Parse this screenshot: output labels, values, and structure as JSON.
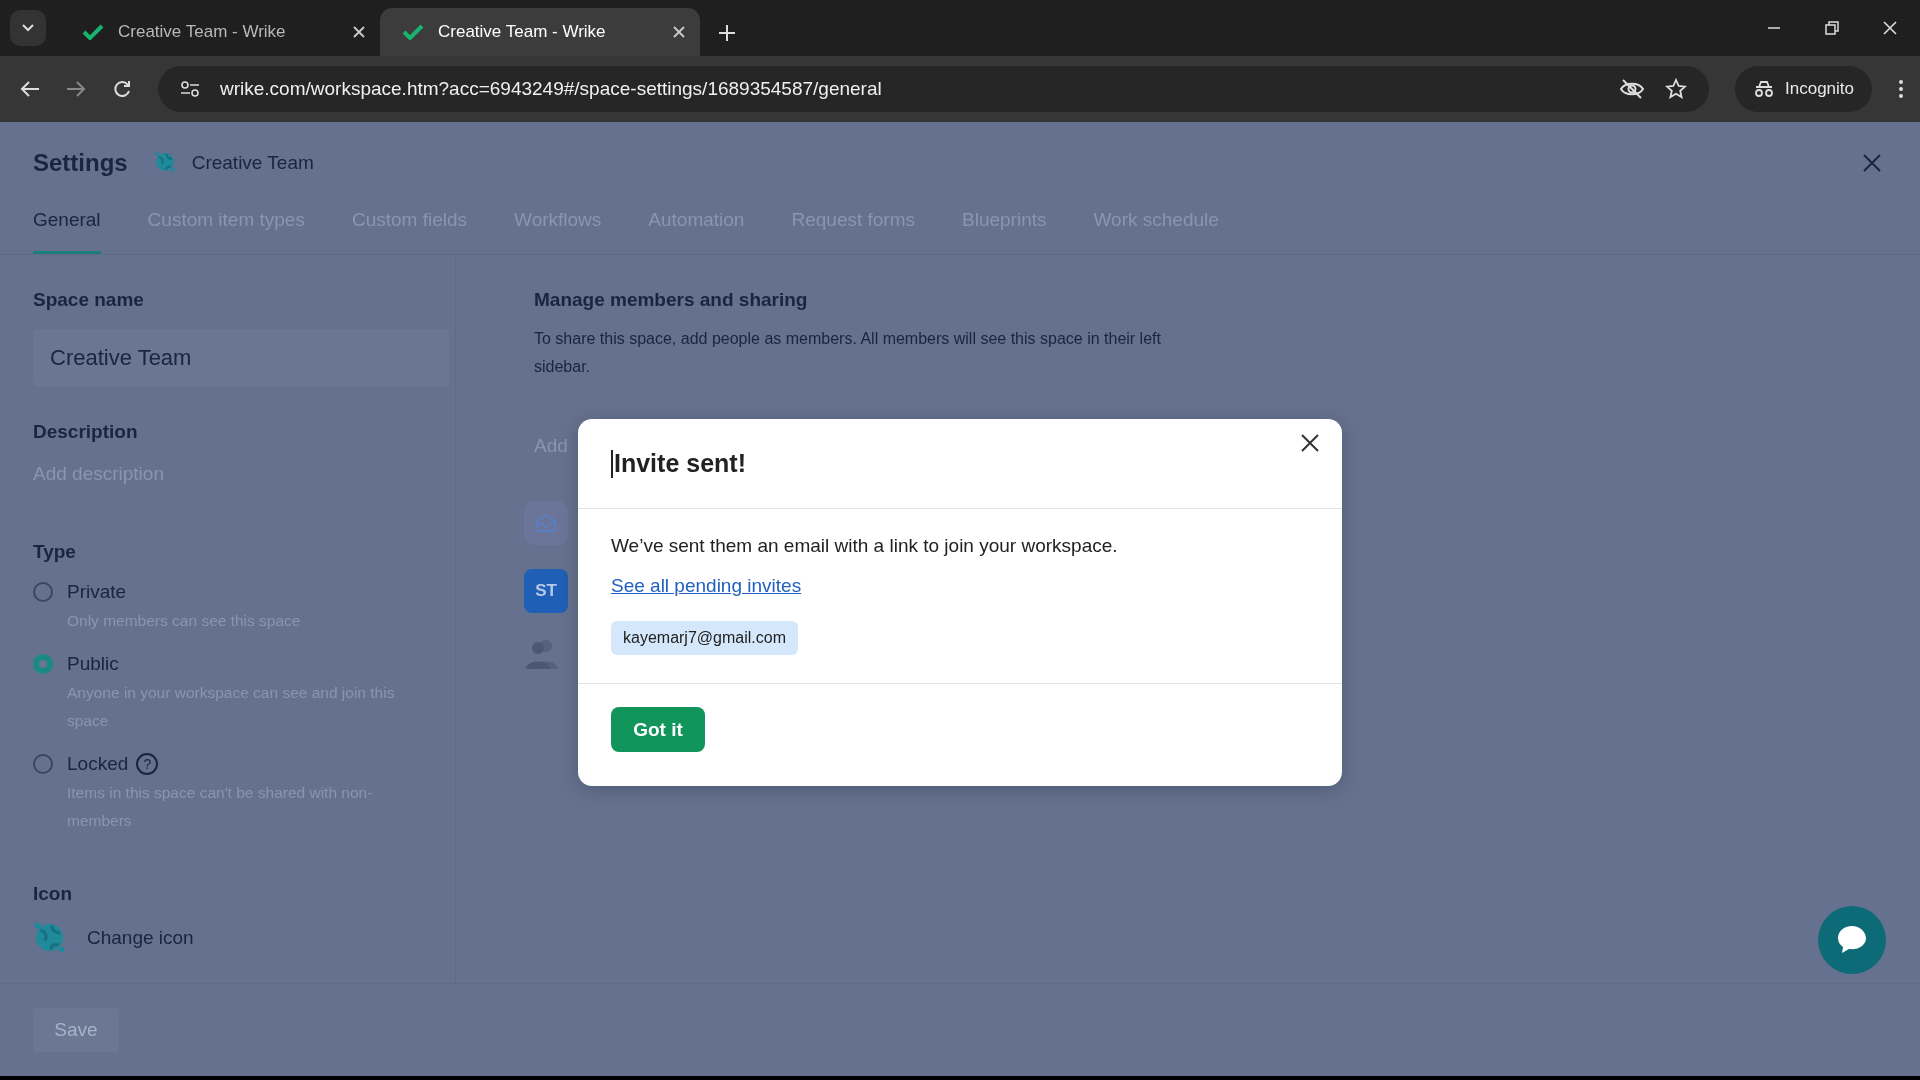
{
  "browser": {
    "tabs": [
      {
        "title": "Creative Team - Wrike",
        "selected": false
      },
      {
        "title": "Creative Team - Wrike",
        "selected": true
      }
    ],
    "url": "wrike.com/workspace.htm?acc=6943249#/space-settings/1689354587/general",
    "profile": "Incognito"
  },
  "settings": {
    "title": "Settings",
    "space": "Creative Team",
    "tabs": [
      {
        "label": "General",
        "selected": true
      },
      {
        "label": "Custom item types",
        "selected": false
      },
      {
        "label": "Custom fields",
        "selected": false
      },
      {
        "label": "Workflows",
        "selected": false
      },
      {
        "label": "Automation",
        "selected": false
      },
      {
        "label": "Request forms",
        "selected": false
      },
      {
        "label": "Blueprints",
        "selected": false
      },
      {
        "label": "Work schedule",
        "selected": false
      }
    ],
    "space_name_label": "Space name",
    "space_name_value": "Creative Team",
    "description_label": "Description",
    "description_placeholder": "Add description",
    "type_label": "Type",
    "types": [
      {
        "label": "Private",
        "hint": "Only members can see this space",
        "selected": false
      },
      {
        "label": "Public",
        "hint": "Anyone in your workspace can see and join this space",
        "selected": true
      },
      {
        "label": "Locked",
        "hint": "Items in this space can't be shared with non-members",
        "selected": false,
        "help": "?"
      }
    ],
    "icon_label": "Icon",
    "change_icon": "Change icon",
    "save": "Save"
  },
  "members": {
    "heading": "Manage members and sharing",
    "text": "To share this space, add people as members. All members will see this space in their left sidebar.",
    "add_placeholder": "Add",
    "avatar": "ST"
  },
  "dialog": {
    "title": "Invite sent!",
    "body": "We’ve sent them an email with a link to join your workspace.",
    "link": "See all pending invites",
    "email": "kayemarj7@gmail.com",
    "button": "Got it"
  }
}
